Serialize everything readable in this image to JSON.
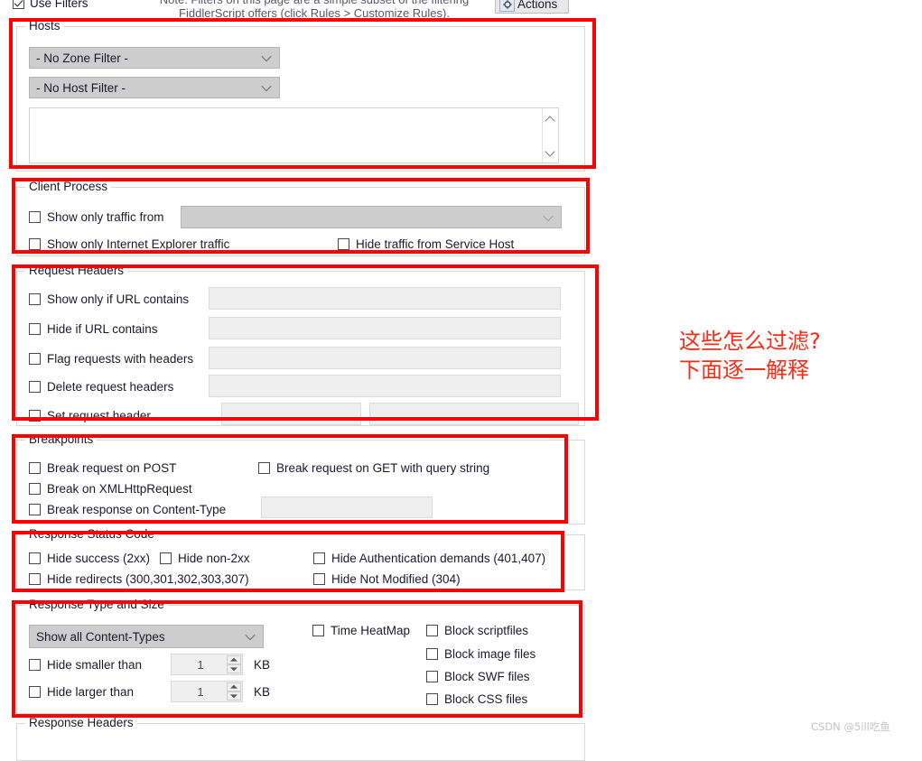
{
  "topbar": {
    "use_filters_label": "Use Filters",
    "use_filters_checked": true,
    "note": "Note: Filters on this page are a simple subset of the filtering FiddlerScript offers (click Rules > Customize Rules).",
    "actions_label": "Actions"
  },
  "hosts": {
    "legend": "Hosts",
    "zone_filter": "- No Zone Filter -",
    "host_filter": "- No Host Filter -",
    "host_list_value": ""
  },
  "client_process": {
    "legend": "Client Process",
    "show_only_traffic_from": "Show only traffic from",
    "process_combo_value": "",
    "show_only_ie": "Show only Internet Explorer traffic",
    "hide_service_host": "Hide traffic from Service Host"
  },
  "request_headers": {
    "legend": "Request Headers",
    "rows": [
      {
        "label": "Show only if URL contains",
        "value": ""
      },
      {
        "label": "Hide if URL contains",
        "value": ""
      },
      {
        "label": "Flag requests with headers",
        "value": ""
      },
      {
        "label": "Delete request headers",
        "value": ""
      }
    ],
    "set_header": {
      "label": "Set request header",
      "name_value": "",
      "val_value": ""
    }
  },
  "breakpoints": {
    "legend": "Breakpoints",
    "break_post": "Break request on POST",
    "break_get_query": "Break request on GET with query string",
    "break_xhr": "Break on XMLHttpRequest",
    "break_response_ct": "Break response on Content-Type",
    "content_type_value": ""
  },
  "status_code": {
    "legend": "Response Status Code",
    "hide_success": "Hide success (2xx)",
    "hide_non_2xx": "Hide non-2xx",
    "hide_auth": "Hide Authentication demands (401,407)",
    "hide_redirects": "Hide redirects (300,301,302,303,307)",
    "hide_not_modified": "Hide Not Modified (304)"
  },
  "response_type": {
    "legend": "Response Type and Size",
    "content_types_combo": "Show all Content-Types",
    "hide_smaller_than": "Hide smaller than",
    "hide_smaller_value": "1",
    "hide_smaller_unit": "KB",
    "hide_larger_than": "Hide larger than",
    "hide_larger_value": "1",
    "hide_larger_unit": "KB",
    "time_heatmap": "Time HeatMap",
    "block_script": "Block scriptfiles",
    "block_image": "Block image files",
    "block_swf": "Block SWF files",
    "block_css": "Block CSS files"
  },
  "response_headers": {
    "legend": "Response Headers"
  },
  "annotation": {
    "text": "这些怎么过滤?\n下面逐一解释",
    "color": "#fd2b16"
  },
  "watermark": {
    "text": "CSDN @5ill吃鱼"
  }
}
